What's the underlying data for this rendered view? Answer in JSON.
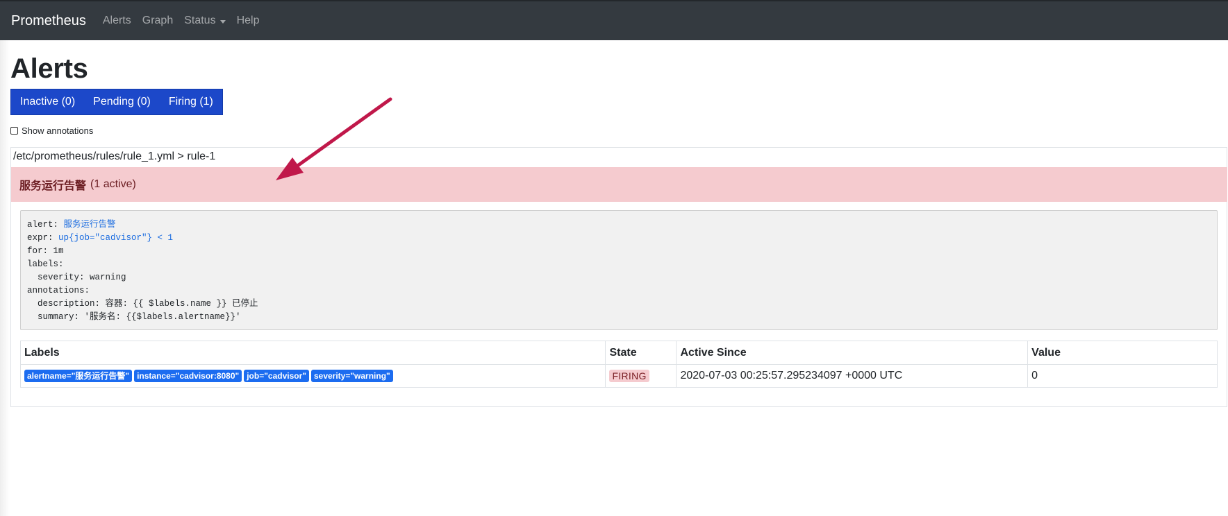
{
  "navbar": {
    "brand": "Prometheus",
    "items": [
      {
        "label": "Alerts"
      },
      {
        "label": "Graph"
      },
      {
        "label": "Status"
      },
      {
        "label": "Help"
      }
    ]
  },
  "page": {
    "title": "Alerts",
    "filters": [
      {
        "label": "Inactive (0)"
      },
      {
        "label": "Pending (0)"
      },
      {
        "label": "Firing (1)"
      }
    ],
    "show_annotations_label": "Show annotations"
  },
  "rule_group": {
    "header": "/etc/prometheus/rules/rule_1.yml > rule-1",
    "alert": {
      "name": "服务运行告警",
      "active_count": "(1 active)",
      "color": "#f5cbcf"
    },
    "rule_yaml": {
      "alert_key": "alert: ",
      "alert_value": "服务运行告警",
      "expr_key": "expr: ",
      "expr_value": "up{job=\"cadvisor\"} < 1",
      "for_line": "for: 1m",
      "labels_line": "labels:",
      "severity_line": "  severity: warning",
      "annotations_line": "annotations:",
      "description_line": "  description: 容器: {{ $labels.name }} 已停止",
      "summary_line": "  summary: '服务名: {{$labels.alertname}}'"
    },
    "table": {
      "headers": {
        "labels": "Labels",
        "state": "State",
        "active_since": "Active Since",
        "value": "Value"
      },
      "rows": [
        {
          "labels": [
            "alertname=\"服务运行告警\"",
            "instance=\"cadvisor:8080\"",
            "job=\"cadvisor\"",
            "severity=\"warning\""
          ],
          "state": "FIRING",
          "active_since": "2020-07-03 00:25:57.295234097 +0000 UTC",
          "value": "0"
        }
      ]
    }
  },
  "colors": {
    "navbar": "#343a40",
    "filter_buttons": "#1c48c9",
    "badge": "#1c6cf0",
    "annotation_arrow": "#c0184a"
  }
}
